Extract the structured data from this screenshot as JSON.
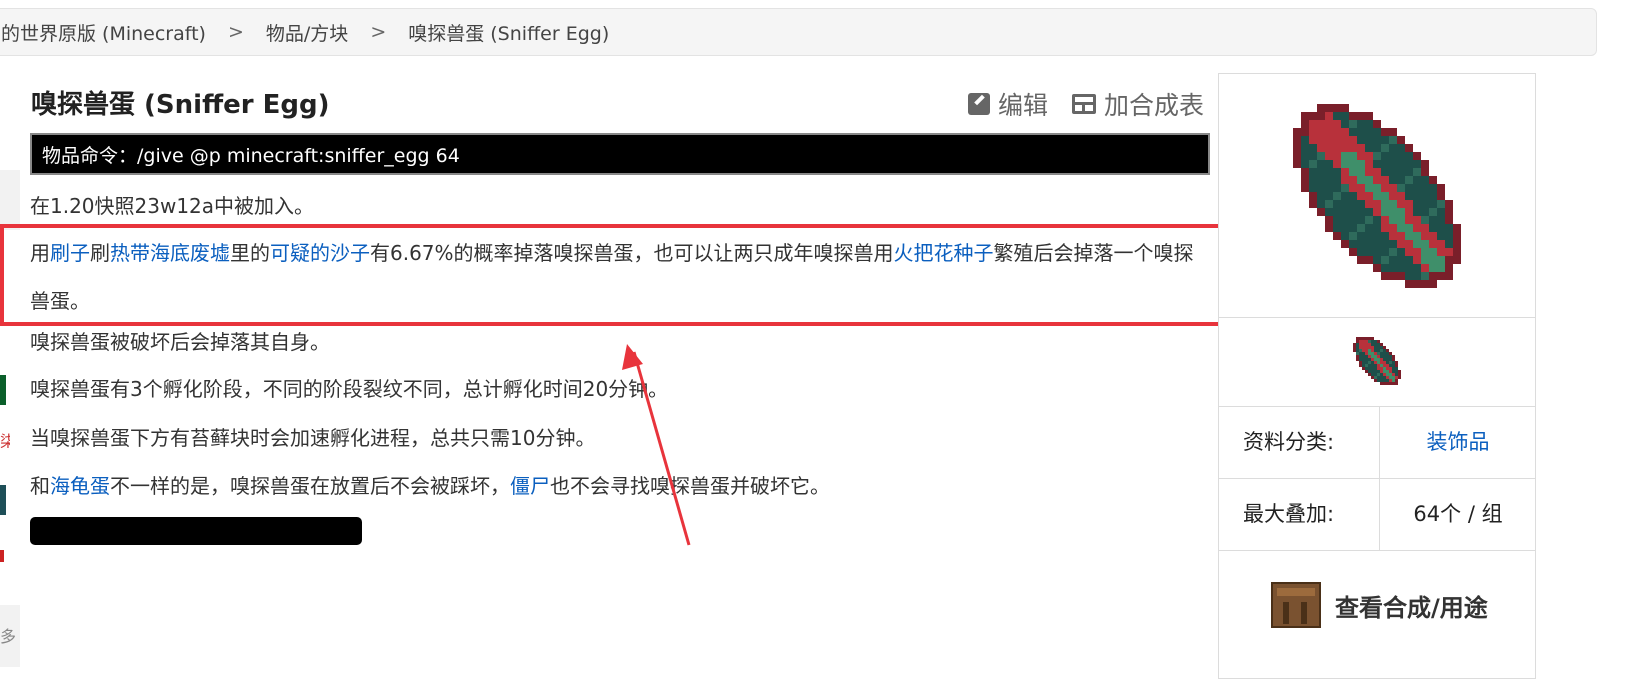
{
  "breadcrumb": {
    "item1": "的世界原版 (Minecraft)",
    "sep": ">",
    "item2": "物品/方块",
    "item3": "嗅探兽蛋 (Sniffer Egg)"
  },
  "page": {
    "title": "嗅探兽蛋 (Sniffer Egg)",
    "edit_label": "编辑",
    "recipe_label": "加合成表",
    "command": "物品命令：/give @p minecraft:sniffer_egg 64"
  },
  "content": {
    "p1": "在1.20快照23w12a中被加入。",
    "p2": {
      "t1": "用",
      "l1": "刷子",
      "t2": "刷",
      "l2": "热带海底废墟",
      "t3": "里的",
      "l3": "可疑的沙子",
      "t4": "有6.67%的概率掉落嗅探兽蛋，也可以让两只成年嗅探兽用",
      "l4": "火把花种子",
      "t5": "繁殖后会掉落一个嗅探兽蛋。"
    },
    "p3": "嗅探兽蛋被破坏后会掉落其自身。",
    "p4": "嗅探兽蛋有3个孵化阶段，不同的阶段裂纹不同，总计孵化时间20分钟。",
    "p5": "当嗅探兽蛋下方有苔藓块时会加速孵化进程，总共只需10分钟。",
    "p6": {
      "t1": "和",
      "l1": "海龟蛋",
      "t2": "不一样的是，嗅探兽蛋在放置后不会被踩坏，",
      "l2": "僵尸",
      "t3": "也不会寻找嗅探兽蛋并破坏它。"
    }
  },
  "infobox": {
    "category_label": "资料分类:",
    "category_value": "装饰品",
    "stack_label": "最大叠加:",
    "stack_value": "64个 / 组",
    "crafting_label": "查看合成/用途"
  },
  "left_edge": {
    "fragment": "多",
    "red_fragment": "柒"
  },
  "colors": {
    "link": "#0b5fbf",
    "highlight": "#e8343c",
    "egg_dark": "#1e4f4a",
    "egg_green": "#3f8f6a",
    "egg_red": "#b8313b"
  }
}
